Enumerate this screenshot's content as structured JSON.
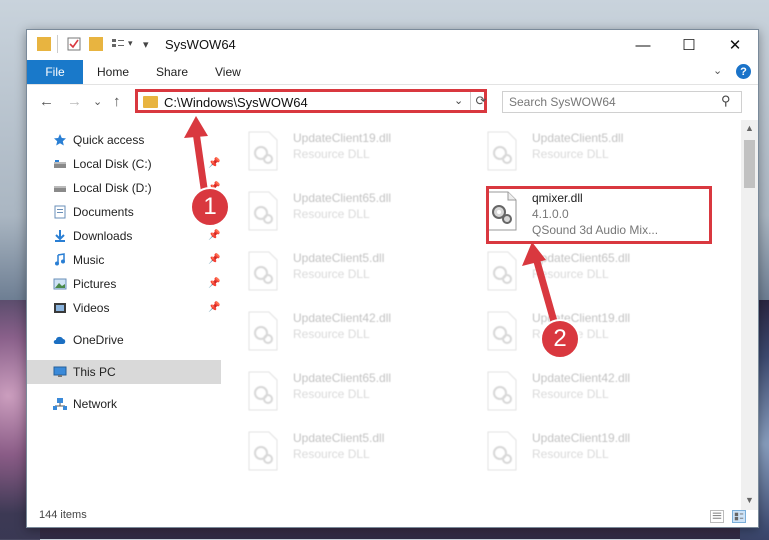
{
  "window": {
    "title": "SysWOW64",
    "controls": {
      "minimize": "—",
      "maximize": "☐",
      "close": "✕"
    }
  },
  "ribbon": {
    "file": "File",
    "tabs": [
      "Home",
      "Share",
      "View"
    ],
    "help": "?",
    "collapse": "⌄"
  },
  "nav": {
    "back": "←",
    "forward": "→",
    "recent": "⌄",
    "up": "↑",
    "address": "C:\\Windows\\SysWOW64",
    "search_placeholder": "Search SysWOW64",
    "refresh": "⟳",
    "dropdown": "⌄",
    "search_icon": "⚲"
  },
  "sidebar": {
    "items": [
      {
        "label": "Quick access",
        "icon": "star-icon",
        "pin": ""
      },
      {
        "label": "Local Disk (C:)",
        "icon": "drive-icon",
        "pin": "📌"
      },
      {
        "label": "Local Disk (D:)",
        "icon": "drive-icon",
        "pin": "📌"
      },
      {
        "label": "Documents",
        "icon": "documents-icon",
        "pin": "📌"
      },
      {
        "label": "Downloads",
        "icon": "download-icon",
        "pin": "📌"
      },
      {
        "label": "Music",
        "icon": "music-icon",
        "pin": "📌"
      },
      {
        "label": "Pictures",
        "icon": "pictures-icon",
        "pin": "📌"
      },
      {
        "label": "Videos",
        "icon": "videos-icon",
        "pin": "📌"
      },
      {
        "label": "OneDrive",
        "icon": "cloud-icon",
        "pin": ""
      },
      {
        "label": "This PC",
        "icon": "computer-icon",
        "pin": ""
      },
      {
        "label": "Network",
        "icon": "network-icon",
        "pin": ""
      }
    ]
  },
  "files": [
    {
      "name": "UpdateClient19.dll",
      "desc": "Resource DLL"
    },
    {
      "name": "UpdateClient5.dll",
      "desc": "Resource DLL"
    },
    {
      "name": "UpdateClient65.dll",
      "desc": "Resource DLL"
    },
    {
      "name": "qmixer.dll",
      "version": "4.1.0.0",
      "desc": "QSound 3d Audio Mix..."
    },
    {
      "name": "UpdateClient5.dll",
      "desc": "Resource DLL"
    },
    {
      "name": "UpdateClient65.dll",
      "desc": "Resource DLL"
    },
    {
      "name": "UpdateClient42.dll",
      "desc": "Resource DLL"
    },
    {
      "name": "UpdateClient19.dll",
      "desc": "Resource DLL"
    },
    {
      "name": "UpdateClient65.dll",
      "desc": "Resource DLL"
    },
    {
      "name": "UpdateClient42.dll",
      "desc": "Resource DLL"
    },
    {
      "name": "UpdateClient5.dll",
      "desc": "Resource DLL"
    },
    {
      "name": "UpdateClient19.dll",
      "desc": "Resource DLL"
    }
  ],
  "status": {
    "count": "144 items"
  },
  "annotations": {
    "step1": "1",
    "step2": "2"
  },
  "colors": {
    "accent": "#1979ca",
    "highlight": "#d9383f",
    "selected": "#d9d9d9"
  }
}
